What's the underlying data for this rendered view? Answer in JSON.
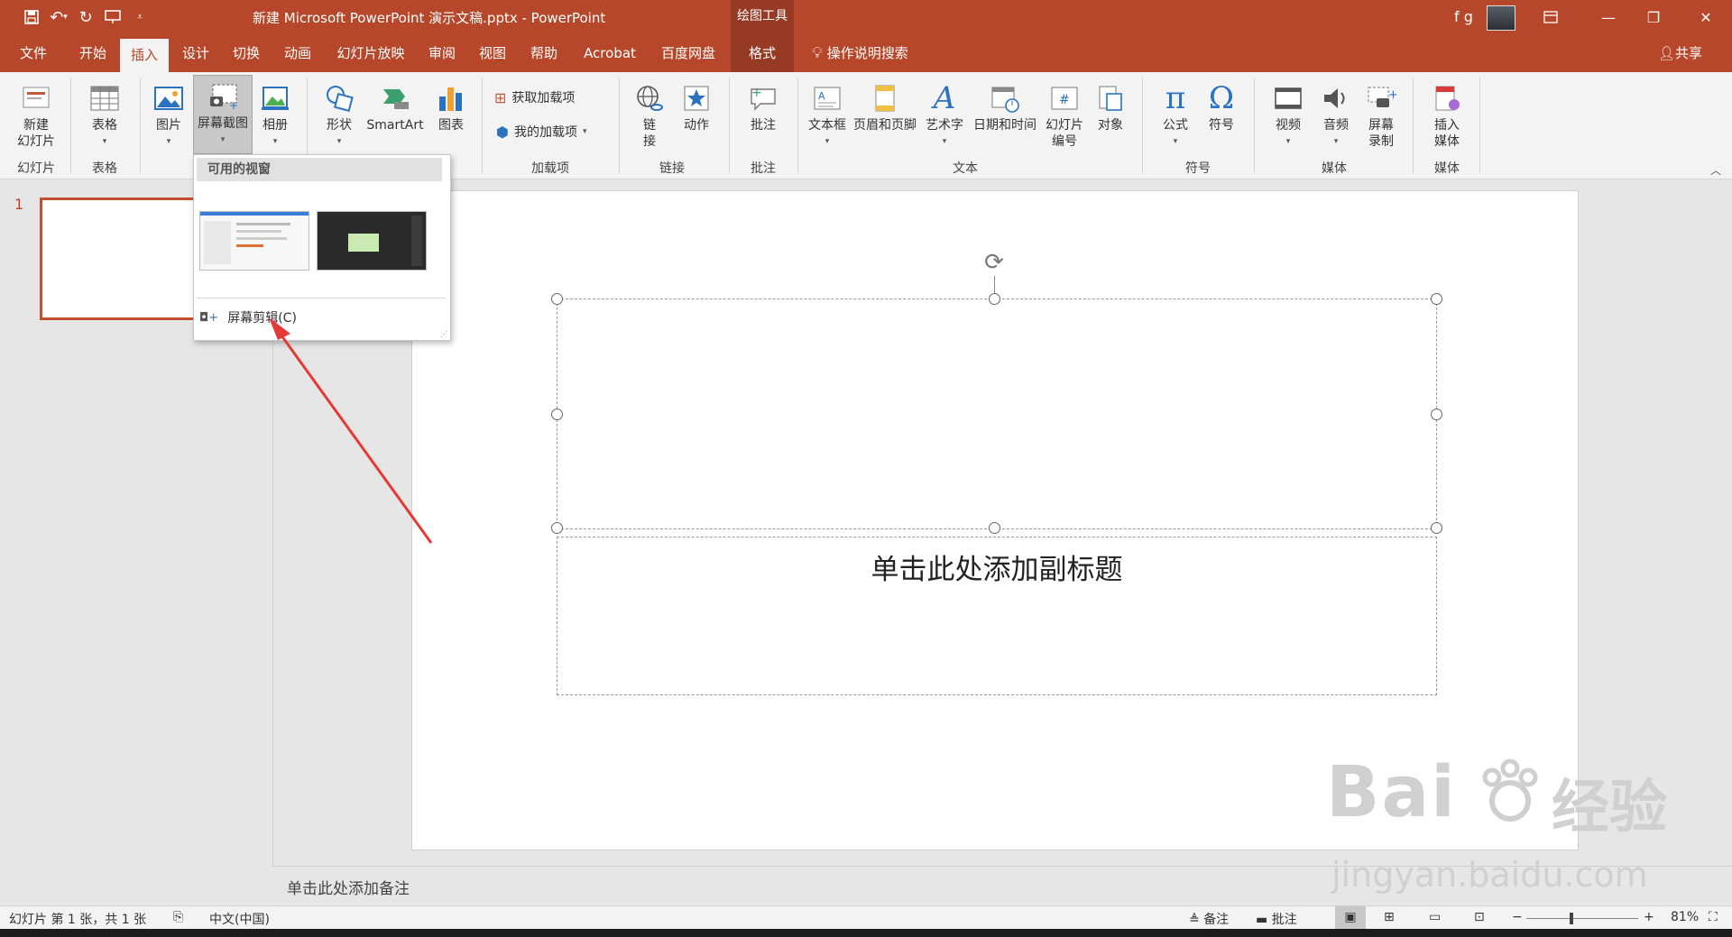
{
  "window": {
    "title": "新建 Microsoft PowerPoint 演示文稿.pptx  -  PowerPoint",
    "context_tools": "绘图工具",
    "user_name": "f g",
    "controls": [
      "minimize",
      "restore",
      "close"
    ]
  },
  "tabs": [
    "文件",
    "开始",
    "插入",
    "设计",
    "切换",
    "动画",
    "幻灯片放映",
    "审阅",
    "视图",
    "帮助",
    "Acrobat",
    "百度网盘",
    "格式"
  ],
  "active_tab": "插入",
  "search_tab": "操作说明搜索",
  "share": "共享",
  "ribbon": {
    "new_slide": "新建\n幻灯片",
    "table": "表格",
    "picture": "图片",
    "screenshot": "屏幕截图",
    "album": "相册",
    "shapes": "形状",
    "smartart": "SmartArt",
    "chart": "图表",
    "get_addins": "获取加载项",
    "my_addins": "我的加载项",
    "link": "链\n接",
    "action": "动作",
    "comment": "批注",
    "textbox": "文本框",
    "header_footer": "页眉和页脚",
    "wordart": "艺术字",
    "datetime": "日期和时间",
    "slide_number": "幻灯片\n编号",
    "object": "对象",
    "equation": "公式",
    "symbol": "符号",
    "video": "视频",
    "audio": "音频",
    "screen_recording": "屏幕\n录制",
    "insert_media": "插入\n媒体",
    "groups": {
      "slides": "幻灯片",
      "tables": "表格",
      "addins": "加载项",
      "links": "链接",
      "comments": "批注",
      "text": "文本",
      "symbols": "符号",
      "media": "媒体",
      "media2": "媒体"
    }
  },
  "dropdown": {
    "header": "可用的视窗",
    "clip_label": "屏幕剪辑(C)"
  },
  "thumbnails": {
    "slide_number": "1"
  },
  "slide": {
    "subtitle_placeholder": "单击此处添加副标题"
  },
  "notes_placeholder": "单击此处添加备注",
  "status": {
    "slide_info": "幻灯片 第 1 张，共 1 张",
    "language": "中文(中国)",
    "notes": "备注",
    "comments": "批注",
    "zoom": "81%"
  },
  "watermark": {
    "brand": "Bai",
    "cn": "经验",
    "url": "jingyan.baidu.com"
  },
  "colors": {
    "accent": "#b7472a",
    "context": "#973a24",
    "arrow": "#e53935"
  }
}
